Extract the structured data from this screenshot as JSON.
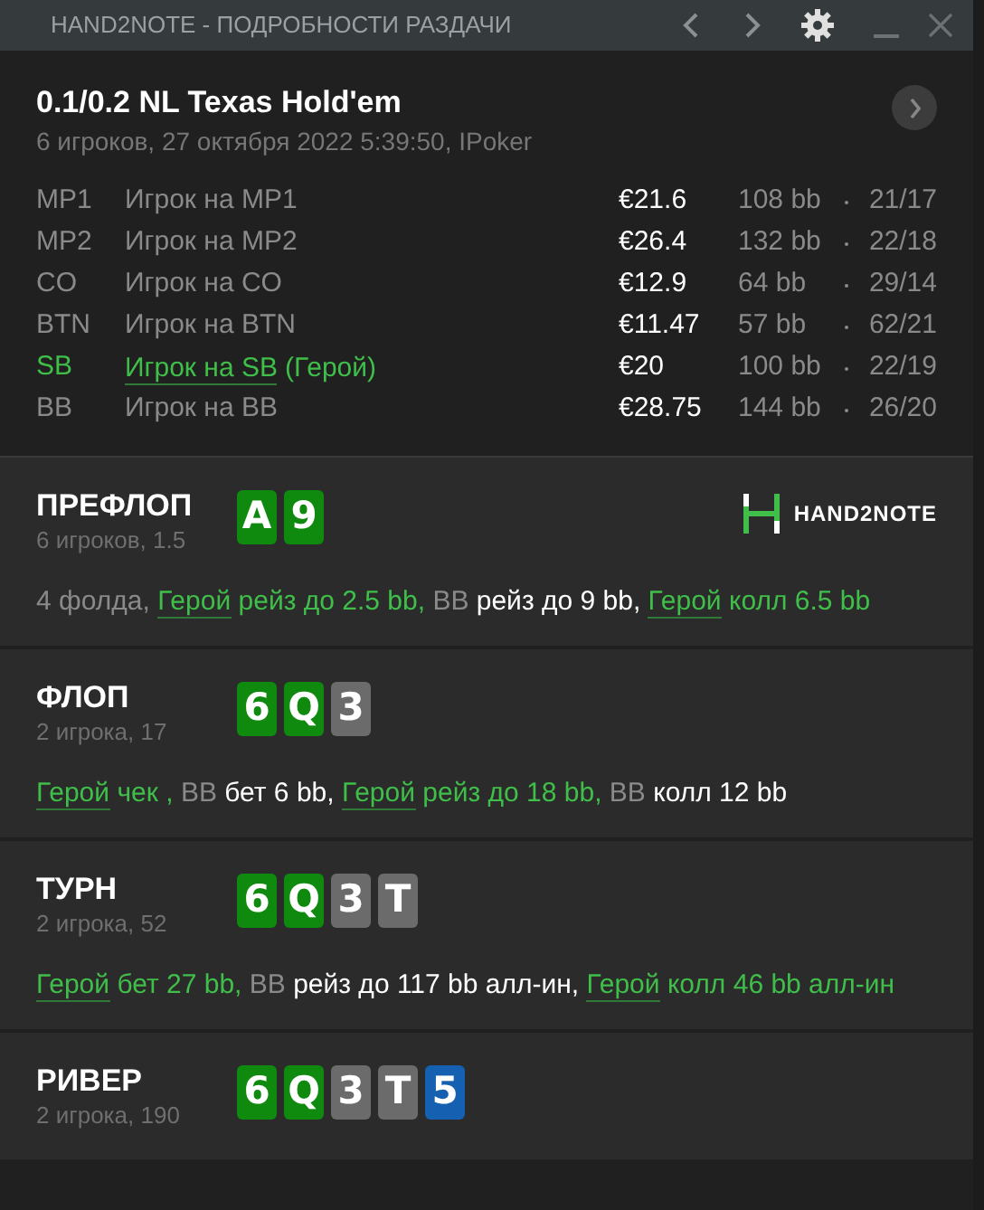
{
  "window": {
    "title": "HAND2NOTE - ПОДРОБНОСТИ РАЗДАЧИ"
  },
  "hand": {
    "title": "0.1/0.2 NL Texas Hold'em",
    "subtitle": "6 игроков, 27 октября 2022 5:39:50, IPoker"
  },
  "players": [
    {
      "position": "MP1",
      "name": "Игрок на MP1",
      "hero": false,
      "stack": "€21.6",
      "bb": "108 bb",
      "stats": "21/17"
    },
    {
      "position": "MP2",
      "name": "Игрок на MP2",
      "hero": false,
      "stack": "€26.4",
      "bb": "132 bb",
      "stats": "22/18"
    },
    {
      "position": "CO",
      "name": "Игрок на CO",
      "hero": false,
      "stack": "€12.9",
      "bb": "64 bb",
      "stats": "29/14"
    },
    {
      "position": "BTN",
      "name": "Игрок на BTN",
      "hero": false,
      "stack": "€11.47",
      "bb": "57 bb",
      "stats": "62/21"
    },
    {
      "position": "SB",
      "name": "Игрок на SB",
      "hero": true,
      "hero_tag": "(Герой)",
      "stack": "€20",
      "bb": "100 bb",
      "stats": "22/19"
    },
    {
      "position": "BB",
      "name": "Игрок на BB",
      "hero": false,
      "stack": "€28.75",
      "bb": "144 bb",
      "stats": "26/20"
    }
  ],
  "streets": [
    {
      "name": "ПРЕФЛОП",
      "info": "6 игроков, 1.5",
      "logo_text": "HAND2NOTE",
      "cards": [
        {
          "rank": "A",
          "color": "#0f8a0f"
        },
        {
          "rank": "9",
          "color": "#0f8a0f"
        }
      ],
      "actions": [
        {
          "kind": "plain",
          "text": "4 фолда,"
        },
        {
          "kind": "hero",
          "actor": "Герой",
          "text": "рейз до 2.5 bb,"
        },
        {
          "kind": "villain",
          "actor": "BB",
          "text": "рейз до 9 bb,"
        },
        {
          "kind": "hero",
          "actor": "Герой",
          "text": "колл 6.5 bb"
        }
      ]
    },
    {
      "name": "ФЛОП",
      "info": "2 игрока, 17",
      "cards": [
        {
          "rank": "6",
          "color": "#0f8a0f"
        },
        {
          "rank": "Q",
          "color": "#0f8a0f"
        },
        {
          "rank": "3",
          "color": "#6b6b6b"
        }
      ],
      "actions": [
        {
          "kind": "hero",
          "actor": "Герой",
          "text": "чек ,"
        },
        {
          "kind": "villain",
          "actor": "BB",
          "text": "бет 6 bb,"
        },
        {
          "kind": "hero",
          "actor": "Герой",
          "text": "рейз до 18 bb,"
        },
        {
          "kind": "villain",
          "actor": "BB",
          "text": "колл 12 bb"
        }
      ]
    },
    {
      "name": "ТУРН",
      "info": "2 игрока, 52",
      "cards": [
        {
          "rank": "6",
          "color": "#0f8a0f"
        },
        {
          "rank": "Q",
          "color": "#0f8a0f"
        },
        {
          "rank": "3",
          "color": "#6b6b6b"
        },
        {
          "rank": "T",
          "color": "#6b6b6b"
        }
      ],
      "actions": [
        {
          "kind": "hero",
          "actor": "Герой",
          "text": "бет 27 bb,"
        },
        {
          "kind": "villain",
          "actor": "BB",
          "text": "рейз до 117 bb алл-ин,"
        },
        {
          "kind": "hero",
          "actor": "Герой",
          "text": "колл 46 bb алл-ин"
        }
      ]
    },
    {
      "name": "РИВЕР",
      "info": "2 игрока, 190",
      "cards": [
        {
          "rank": "6",
          "color": "#0f8a0f"
        },
        {
          "rank": "Q",
          "color": "#0f8a0f"
        },
        {
          "rank": "3",
          "color": "#6b6b6b"
        },
        {
          "rank": "T",
          "color": "#6b6b6b"
        },
        {
          "rank": "5",
          "color": "#1560b0"
        }
      ]
    }
  ]
}
